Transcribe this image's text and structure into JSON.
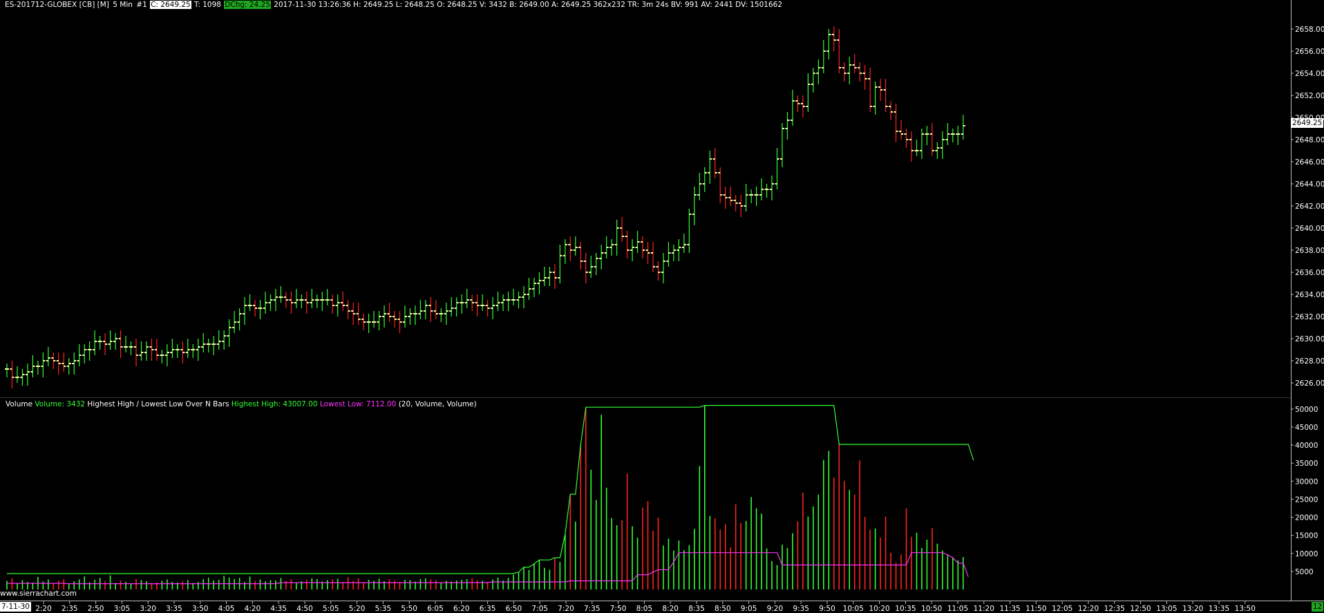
{
  "header": {
    "symbol": "ES-201712-GLOBEX [CB] [M]",
    "interval": "5 Min",
    "chart_num": "#1",
    "close": "C: 2649.25",
    "trades": "T: 1098",
    "dchg": "DChg: 24.25",
    "rest": "2017-11-30 13:26:36 H: 2649.25 L: 2648.25 O: 2648.25 V: 3432 B: 2649.00 A: 2649.25 362x232 TR: 3m 24s BV: 991 AV: 2441 DV: 1501662"
  },
  "subgraph": {
    "name": "Volume",
    "volume": "Volume: 3432",
    "study": "Highest High / Lowest Low Over N Bars",
    "highest": "Highest High: 43007.00",
    "lowest": "Lowest Low: 7112.00",
    "params": "(20, Volume, Volume)"
  },
  "watermark": "www.sierrachart.com",
  "price_tag": "2649.25",
  "date_tag": "7-11-30",
  "right_tag": "12",
  "colors": {
    "up": "#33ff33",
    "down": "#ff2222",
    "bar_up": "#33ff33",
    "highest": "#33ff33",
    "lowest": "#ff33ff",
    "cyan": "#33ccff"
  },
  "chart_data": {
    "type": "ohlc",
    "price_axis": {
      "ylim": [
        2625,
        2659.5
      ],
      "ticks": [
        "2626.00",
        "2628.00",
        "2630.00",
        "2632.00",
        "2634.00",
        "2636.00",
        "2638.00",
        "2640.00",
        "2642.00",
        "2644.00",
        "2646.00",
        "2648.00",
        "2650.00",
        "2652.00",
        "2654.00",
        "2656.00",
        "2658.00"
      ]
    },
    "volume_axis": {
      "ylim": [
        0,
        51500
      ],
      "ticks": [
        "5000",
        "10000",
        "15000",
        "20000",
        "25000",
        "30000",
        "35000",
        "40000",
        "45000",
        "50000"
      ]
    },
    "time_ticks": [
      "2:20",
      "2:35",
      "2:50",
      "3:05",
      "3:20",
      "3:35",
      "3:50",
      "4:05",
      "4:20",
      "4:35",
      "4:50",
      "5:05",
      "5:20",
      "5:35",
      "5:50",
      "6:05",
      "6:20",
      "6:35",
      "6:50",
      "7:05",
      "7:20",
      "7:35",
      "7:50",
      "8:05",
      "8:20",
      "8:35",
      "8:50",
      "9:05",
      "9:20",
      "9:35",
      "9:50",
      "10:05",
      "10:20",
      "10:35",
      "10:50",
      "11:05",
      "11:20",
      "11:35",
      "11:50",
      "12:05",
      "12:20",
      "12:35",
      "12:50",
      "13:05",
      "13:20",
      "13:35",
      "13:50"
    ],
    "close": [
      2627.25,
      2626.5,
      2626.5,
      2626.75,
      2627.0,
      2627.5,
      2627.5,
      2628.0,
      2628.25,
      2628.0,
      2627.75,
      2627.5,
      2627.75,
      2628.0,
      2628.5,
      2629.0,
      2629.0,
      2629.75,
      2629.75,
      2629.5,
      2629.75,
      2630.0,
      2629.25,
      2629.25,
      2629.25,
      2628.5,
      2628.75,
      2629.25,
      2629.0,
      2628.5,
      2628.5,
      2628.75,
      2629.0,
      2629.0,
      2628.75,
      2629.0,
      2629.0,
      2629.25,
      2629.5,
      2629.5,
      2629.5,
      2629.75,
      2630.25,
      2631.0,
      2631.5,
      2632.25,
      2633.0,
      2633.0,
      2632.75,
      2632.75,
      2633.25,
      2633.5,
      2633.75,
      2633.75,
      2633.5,
      2633.25,
      2633.5,
      2633.5,
      2633.25,
      2633.5,
      2633.5,
      2633.5,
      2633.5,
      2633.0,
      2633.25,
      2633.0,
      2632.5,
      2632.25,
      2631.75,
      2631.5,
      2631.5,
      2631.5,
      2632.0,
      2632.25,
      2632.0,
      2631.75,
      2631.5,
      2632.0,
      2632.25,
      2632.25,
      2632.5,
      2633.0,
      2632.5,
      2632.25,
      2632.25,
      2632.5,
      2632.75,
      2633.25,
      2633.25,
      2633.5,
      2633.25,
      2633.0,
      2633.0,
      2632.75,
      2633.0,
      2633.25,
      2633.5,
      2633.5,
      2633.5,
      2633.75,
      2634.0,
      2634.5,
      2635.0,
      2635.25,
      2635.5,
      2636.0,
      2635.5,
      2637.5,
      2638.5,
      2638.0,
      2638.25,
      2637.0,
      2636.0,
      2636.5,
      2637.25,
      2637.75,
      2638.25,
      2638.5,
      2640.0,
      2639.25,
      2638.0,
      2638.25,
      2638.75,
      2638.0,
      2637.75,
      2636.5,
      2636.0,
      2637.0,
      2637.75,
      2638.0,
      2638.25,
      2638.5,
      2641.25,
      2643.0,
      2644.0,
      2645.0,
      2646.25,
      2645.0,
      2643.0,
      2642.75,
      2642.5,
      2642.25,
      2642.0,
      2643.0,
      2643.0,
      2643.0,
      2643.5,
      2643.5,
      2644.0,
      2646.25,
      2649.0,
      2649.75,
      2651.5,
      2651.25,
      2651.0,
      2653.0,
      2654.0,
      2654.5,
      2656.0,
      2657.5,
      2657.0,
      2654.5,
      2654.0,
      2654.75,
      2654.5,
      2654.0,
      2653.5,
      2651.0,
      2652.75,
      2652.5,
      2651.0,
      2650.5,
      2648.75,
      2648.5,
      2648.0,
      2647.0,
      2647.0,
      2648.5,
      2648.5,
      2647.0,
      2647.25,
      2648.0,
      2648.5,
      2648.5,
      2648.5,
      2649.25
    ],
    "volume": [
      2400,
      3100,
      1800,
      2600,
      2100,
      1900,
      3500,
      2200,
      2800,
      1700,
      2500,
      2900,
      1600,
      2300,
      2800,
      3600,
      2000,
      2700,
      3200,
      2400,
      3900,
      1800,
      2500,
      2100,
      1700,
      2900,
      2600,
      2300,
      1800,
      2000,
      2400,
      2800,
      2100,
      1900,
      2300,
      2600,
      1800,
      2100,
      2900,
      3300,
      2500,
      2700,
      3800,
      3300,
      2900,
      3200,
      2100,
      3600,
      2400,
      2800,
      2300,
      2600,
      2500,
      3200,
      2400,
      2800,
      1900,
      2300,
      2700,
      3100,
      2900,
      2200,
      2600,
      2800,
      3000,
      2100,
      3400,
      2400,
      3100,
      1900,
      2700,
      2400,
      3000,
      2300,
      2800,
      2500,
      2100,
      2700,
      2600,
      2200,
      2900,
      3100,
      2800,
      2600,
      1900,
      2400,
      2200,
      2500,
      2700,
      2900,
      3100,
      2600,
      2400,
      2100,
      2800,
      3300,
      2500,
      3200,
      4100,
      4800,
      6200,
      5400,
      7100,
      8200,
      6000,
      5500,
      8800,
      7600,
      15300,
      26400,
      18800,
      40100,
      50500,
      33200,
      24800,
      48400,
      28200,
      19800,
      17800,
      19200,
      32100,
      17500,
      14400,
      22700,
      24500,
      16300,
      19900,
      12200,
      14100,
      10800,
      13600,
      10900,
      12300,
      16800,
      34200,
      51000,
      20400,
      19700,
      16600,
      18100,
      11700,
      23600,
      18400,
      19000,
      25600,
      22500,
      21000,
      11400,
      7900,
      6800,
      12400,
      11500,
      15600,
      18900,
      26800,
      20200,
      23000,
      26300,
      35900,
      38400,
      31000,
      40200,
      30100,
      27600,
      26300,
      35800,
      20100,
      16600,
      16900,
      14400,
      20200,
      10200,
      7400,
      9700,
      22500,
      14600,
      15700,
      11500,
      13800,
      17000,
      12700,
      10800,
      9600,
      8800,
      8100,
      9000,
      7300,
      3500
    ],
    "highest_high": [
      4400,
      4400,
      4400,
      4400,
      4400,
      4400,
      4400,
      4400,
      4400,
      4400,
      4400,
      4400,
      4400,
      4400,
      4400,
      4400,
      4400,
      4400,
      4400,
      4400,
      4400,
      4400,
      4400,
      4400,
      4400,
      4400,
      4400,
      4400,
      4400,
      4400,
      4400,
      4400,
      4400,
      4400,
      4400,
      4400,
      4400,
      4400,
      4400,
      4400,
      4400,
      4400,
      4400,
      4400,
      4400,
      4400,
      4400,
      4400,
      4400,
      4400,
      4400,
      4400,
      4400,
      4400,
      4400,
      4400,
      4400,
      4400,
      4400,
      4400,
      4400,
      4400,
      4400,
      4400,
      4400,
      4400,
      4400,
      4400,
      4400,
      4400,
      4400,
      4400,
      4400,
      4400,
      4400,
      4400,
      4400,
      4400,
      4400,
      4400,
      4400,
      4400,
      4400,
      4400,
      4400,
      4400,
      4400,
      4400,
      4400,
      4400,
      4400,
      4400,
      4400,
      4400,
      4400,
      4400,
      4400,
      4400,
      4400,
      4800,
      6200,
      6200,
      7100,
      8200,
      8200,
      8200,
      8800,
      8800,
      15300,
      26400,
      26400,
      40100,
      50500,
      50500,
      50500,
      50500,
      50500,
      50500,
      50500,
      50500,
      50500,
      50500,
      50500,
      50500,
      50500,
      50500,
      50500,
      50500,
      50500,
      50500,
      50500,
      50500,
      50500,
      50500,
      50500,
      51000,
      51000,
      51000,
      51000,
      51000,
      51000,
      51000,
      51000,
      51000,
      51000,
      51000,
      51000,
      51000,
      51000,
      51000,
      51000,
      51000,
      51000,
      51000,
      51000,
      51000,
      51000,
      51000,
      51000,
      51000,
      51000,
      40200,
      40200,
      40200,
      40200,
      40200,
      40200,
      40200,
      40200,
      40200,
      40200,
      40200,
      40200,
      40200,
      40200,
      40200,
      40200,
      40200,
      40200,
      40200,
      40200,
      40200,
      40200,
      40200,
      40200,
      40200,
      40200,
      35800
    ],
    "lowest_low": [
      1700,
      1700,
      1700,
      1700,
      1700,
      1700,
      1700,
      1700,
      1700,
      1700,
      1700,
      1700,
      1600,
      1600,
      1600,
      1600,
      1600,
      1600,
      1600,
      1600,
      1600,
      1600,
      1600,
      1600,
      1600,
      1600,
      1600,
      1600,
      1600,
      1600,
      1600,
      1600,
      1600,
      1600,
      1600,
      1600,
      1600,
      1600,
      1600,
      1600,
      1600,
      1600,
      1600,
      1600,
      1600,
      1600,
      1600,
      1600,
      1600,
      1600,
      1600,
      1600,
      1600,
      1900,
      1900,
      1900,
      1900,
      1900,
      1900,
      1900,
      1900,
      1900,
      1900,
      1900,
      1900,
      1900,
      1900,
      1900,
      1900,
      1900,
      1900,
      1900,
      1900,
      1900,
      1900,
      1900,
      1900,
      1900,
      1900,
      1900,
      1900,
      1900,
      1900,
      1900,
      1900,
      1900,
      1900,
      1900,
      1900,
      1900,
      1900,
      1900,
      1900,
      1900,
      2100,
      2100,
      2100,
      2100,
      2100,
      2100,
      2100,
      2100,
      2100,
      2100,
      2100,
      2100,
      2100,
      2100,
      2100,
      2400,
      2400,
      2400,
      2400,
      2400,
      2400,
      2400,
      2400,
      2400,
      2400,
      2400,
      2400,
      2400,
      4100,
      4100,
      4100,
      4800,
      5500,
      5500,
      5500,
      7600,
      10200,
      10200,
      10200,
      10200,
      10200,
      10200,
      10200,
      10200,
      10200,
      10200,
      10200,
      10200,
      10200,
      10200,
      10200,
      10200,
      10200,
      10200,
      10200,
      10200,
      6800,
      6800,
      6800,
      6800,
      6800,
      6800,
      6800,
      6800,
      6800,
      6800,
      6800,
      6800,
      6800,
      6800,
      6800,
      6800,
      6800,
      6800,
      6800,
      6800,
      6800,
      6800,
      6800,
      6800,
      6800,
      10200,
      10200,
      10200,
      10200,
      10200,
      10200,
      10200,
      9600,
      8800,
      7300,
      7300,
      3500
    ]
  }
}
